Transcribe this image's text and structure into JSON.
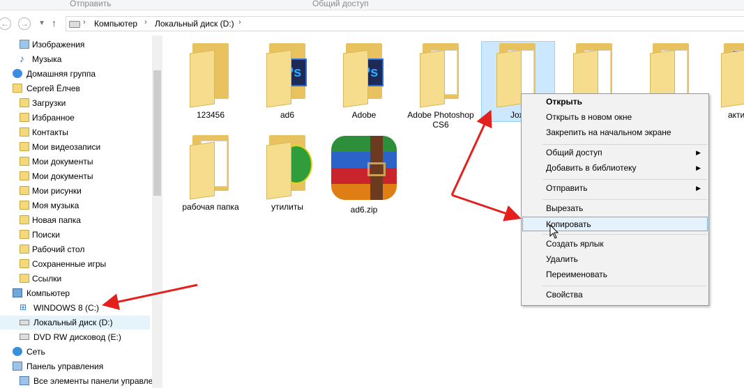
{
  "ribbon": {
    "send": "Отправить",
    "share": "Общий доступ"
  },
  "nav": {
    "path": [
      "Компьютер",
      "Локальный диск (D:)"
    ]
  },
  "sidebar": {
    "items": [
      {
        "label": "Изображения",
        "icon": "pictures-icon"
      },
      {
        "label": "Музыка",
        "icon": "music-icon"
      },
      {
        "label": "Домашняя группа",
        "icon": "homegroup-icon"
      },
      {
        "label": "Сергей Ёлчев",
        "icon": "user-folder-icon"
      },
      {
        "label": "Загрузки",
        "icon": "folder-icon"
      },
      {
        "label": "Избранное",
        "icon": "folder-icon"
      },
      {
        "label": "Контакты",
        "icon": "folder-icon"
      },
      {
        "label": "Мои видеозаписи",
        "icon": "folder-icon"
      },
      {
        "label": "Мои документы",
        "icon": "folder-icon"
      },
      {
        "label": "Мои документы",
        "icon": "folder-icon"
      },
      {
        "label": "Мои рисунки",
        "icon": "folder-icon"
      },
      {
        "label": "Моя музыка",
        "icon": "folder-icon"
      },
      {
        "label": "Новая папка",
        "icon": "folder-icon"
      },
      {
        "label": "Поиски",
        "icon": "folder-icon"
      },
      {
        "label": "Рабочий стол",
        "icon": "folder-icon"
      },
      {
        "label": "Сохраненные игры",
        "icon": "folder-icon"
      },
      {
        "label": "Ссылки",
        "icon": "folder-icon"
      },
      {
        "label": "Компьютер",
        "icon": "computer-icon"
      },
      {
        "label": "WINDOWS 8 (C:)",
        "icon": "windows-drive-icon"
      },
      {
        "label": "Локальный диск (D:)",
        "icon": "drive-icon"
      },
      {
        "label": "DVD RW дисковод (E:)",
        "icon": "dvd-drive-icon"
      },
      {
        "label": "Сеть",
        "icon": "network-icon"
      },
      {
        "label": "Панель управления",
        "icon": "control-panel-icon"
      },
      {
        "label": "Все элементы панели управле",
        "icon": "control-panel-icon"
      }
    ]
  },
  "files": [
    {
      "label": "123456"
    },
    {
      "label": "ad6"
    },
    {
      "label": "Adobe"
    },
    {
      "label": "Adobe Photoshop CS6"
    },
    {
      "label": "Jox"
    },
    {
      "label": ""
    },
    {
      "label": ""
    },
    {
      "label": "акти"
    },
    {
      "label": "рабочая папка"
    },
    {
      "label": "утилиты"
    },
    {
      "label": "ad6.zip"
    }
  ],
  "context_menu": {
    "open": "Открыть",
    "open_new_window": "Открыть в новом окне",
    "pin_start": "Закрепить на начальном экране",
    "share": "Общий доступ",
    "add_library": "Добавить в библиотеку",
    "send_to": "Отправить",
    "cut": "Вырезать",
    "copy": "Копировать",
    "create_shortcut": "Создать ярлык",
    "delete": "Удалить",
    "rename": "Переименовать",
    "properties": "Свойства"
  },
  "colors": {
    "annotation_arrow": "#e3201b",
    "highlight": "#e5f1fb",
    "selection": "#cce8ff"
  }
}
